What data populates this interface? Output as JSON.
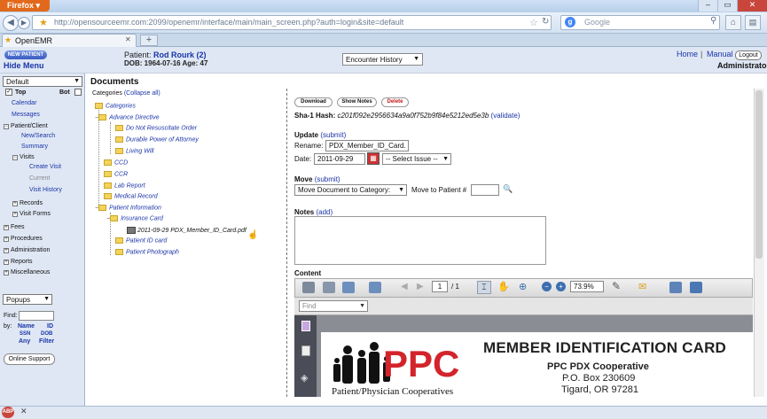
{
  "browser": {
    "menu_label": "Firefox",
    "url": "http://opensourceemr.com:2099/openemr/interface/main/main_screen.php?auth=login&site=default",
    "search_placeholder": "Google",
    "tab_label": "OpenEMR",
    "new_tab": "+"
  },
  "header": {
    "new_patient": "NEW PATIENT",
    "hide_menu": "Hide Menu",
    "patient_label": "Patient:",
    "patient_name": "Rod Rourk (2)",
    "dob": "DOB: 1964-07-16 Age: 47",
    "encounter_select": "Encounter History",
    "home": "Home",
    "manual": "Manual",
    "logout": "Logout",
    "user": "Administrator"
  },
  "leftnav": {
    "layout_select": "Default",
    "top_label": "Top",
    "bot_label": "Bot",
    "items": {
      "calendar": "Calendar",
      "messages": "Messages",
      "patient_client": "Patient/Client",
      "new_search": "New/Search",
      "summary": "Summary",
      "visits": "Visits",
      "create_visit": "Create Visit",
      "current": "Current",
      "visit_history": "Visit History",
      "records": "Records",
      "visit_forms": "Visit Forms",
      "fees": "Fees",
      "procedures": "Procedures",
      "administration": "Administration",
      "reports": "Reports",
      "miscellaneous": "Miscellaneous"
    },
    "popups": "Popups",
    "find_label": "Find:",
    "by_label": "by:",
    "find_by": [
      "Name",
      "ID",
      "SSN",
      "DOB",
      "Any",
      "Filter"
    ],
    "online_support": "Online Support"
  },
  "documents": {
    "title": "Documents",
    "categories": "Categories",
    "collapse": "(Collapse all)",
    "tree": {
      "root": "Categories",
      "advance_directive": "Advance Directive",
      "dnr": "Do Not Resuscitate Order",
      "poa": "Durable Power of Attorney",
      "living_will": "Living Will",
      "ccd": "CCD",
      "ccr": "CCR",
      "lab_report": "Lab Report",
      "medical_record": "Medical Record",
      "patient_information": "Patient Information",
      "insurance_card": "Insurance Card",
      "file": "2011-09-29 PDX_Member_ID_Card.pdf",
      "patient_id_card": "Patient ID card",
      "patient_photograph": "Patient Photograph"
    }
  },
  "detail": {
    "download": "Download",
    "show_notes": "Show Notes",
    "delete": "Delete",
    "hash_label": "Sha-1 Hash:",
    "hash": "c201f092e2956634a9a0f752b9f84e5212ed5e3b",
    "validate": "(validate)",
    "update_label": "Update",
    "submit": "(submit)",
    "rename_label": "Rename:",
    "rename_value": "PDX_Member_ID_Card.",
    "date_label": "Date:",
    "date_value": "2011-09-29",
    "issue_select": "-- Select Issue --",
    "move_label": "Move",
    "move_select": "Move Document to Category:",
    "move_to_patient": "Move to Patient #",
    "notes_label": "Notes",
    "notes_add": "(add)",
    "content_label": "Content"
  },
  "pdf": {
    "page_value": "1",
    "page_total": "/ 1",
    "zoom": "73.9%",
    "find_placeholder": "Find",
    "card_title": "MEMBER IDENTIFICATION CARD",
    "card_org": "PPC PDX Cooperative",
    "card_box": "P.O. Box 230609",
    "card_city": "Tigard, OR 97281",
    "logo_text": "PPC",
    "logo_sub": "Patient/Physician Cooperatives"
  },
  "colors": {
    "accent": "#1a35a8",
    "logo_red": "#d3242b",
    "firefox": "#e2691b"
  }
}
